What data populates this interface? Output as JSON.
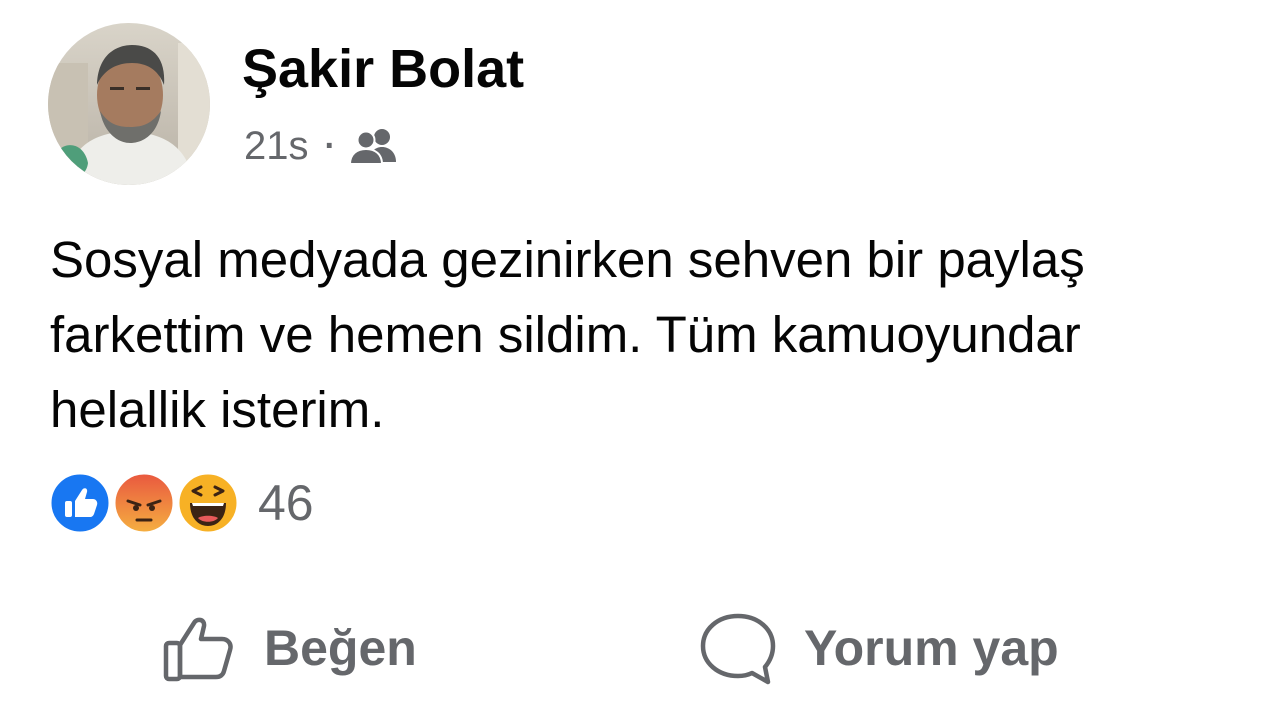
{
  "post": {
    "author": {
      "name": "Şakir Bolat"
    },
    "time": "21s",
    "separator": "·",
    "audience_icon": "friends-icon",
    "text_lines": [
      "Sosyal medyada gezinirken sehven bir paylaş",
      "farkettim ve hemen sildim. Tüm kamuoyundar",
      "helallik isterim."
    ],
    "reactions": {
      "icons": [
        "like-reaction-icon",
        "angry-reaction-icon",
        "haha-reaction-icon"
      ],
      "count": "46"
    },
    "actions": {
      "like_label": "Beğen",
      "comment_label": "Yorum yap"
    }
  },
  "colors": {
    "text": "#050505",
    "secondary_text": "#65676b",
    "like_blue": "#1877f2",
    "reaction_orange": "#f7b125"
  }
}
